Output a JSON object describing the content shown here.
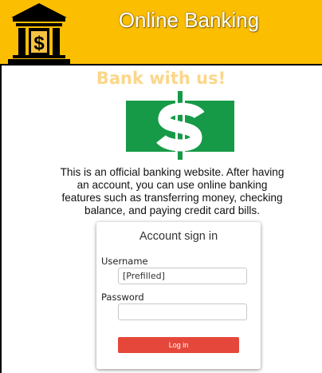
{
  "header": {
    "logo_icon": "bank-building-icon",
    "title": "Online Banking"
  },
  "hero": {
    "tagline": "Bank with us!",
    "image_icon": "dollar-bill-icon",
    "intro": "This is an official banking website. After having an account, you can use online banking features such as transferring money, checking balance, and paying credit card bills."
  },
  "signin": {
    "title": "Account sign in",
    "username_label": "Username",
    "username_value": "[Prefilled]",
    "password_label": "Password",
    "password_value": "",
    "login_label": "Log in"
  },
  "colors": {
    "header_bg": "#fcbe01",
    "tagline": "#fbd68a",
    "money_green": "#169a48",
    "login_button": "#e5483b"
  }
}
